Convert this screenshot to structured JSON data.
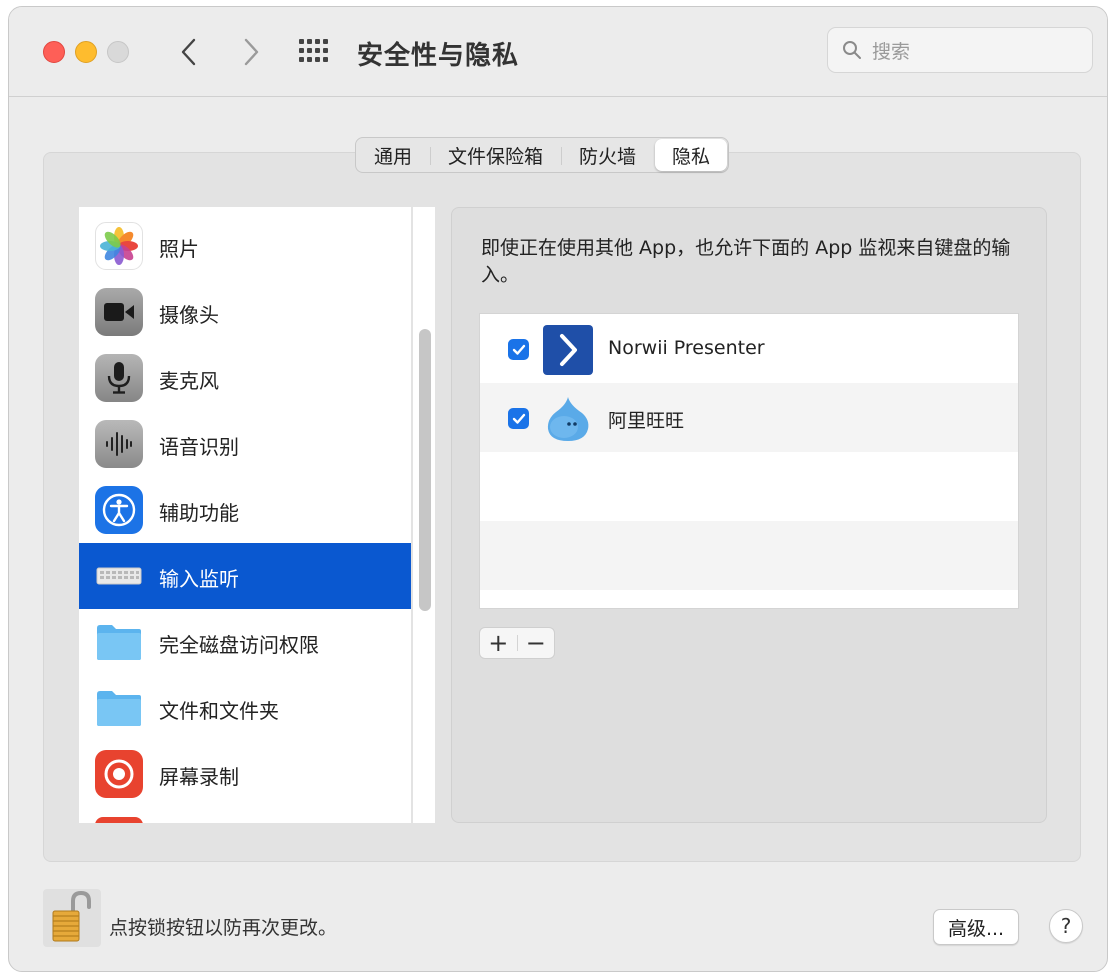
{
  "window": {
    "title": "安全性与隐私",
    "search_placeholder": "搜索"
  },
  "tabs": [
    {
      "label": "通用",
      "active": false
    },
    {
      "label": "文件保险箱",
      "active": false
    },
    {
      "label": "防火墙",
      "active": false
    },
    {
      "label": "隐私",
      "active": true
    }
  ],
  "sidebar": {
    "items": [
      {
        "label": "照片",
        "icon": "photos-icon"
      },
      {
        "label": "摄像头",
        "icon": "camera-icon"
      },
      {
        "label": "麦克风",
        "icon": "microphone-icon"
      },
      {
        "label": "语音识别",
        "icon": "speech-recognition-icon"
      },
      {
        "label": "辅助功能",
        "icon": "accessibility-icon"
      },
      {
        "label": "输入监听",
        "icon": "keyboard-icon",
        "selected": true
      },
      {
        "label": "完全磁盘访问权限",
        "icon": "folder-icon"
      },
      {
        "label": "文件和文件夹",
        "icon": "folder-icon"
      },
      {
        "label": "屏幕录制",
        "icon": "screen-recording-icon"
      }
    ]
  },
  "main": {
    "description": "即使正在使用其他 App，也允许下面的 App 监视来自键盘的输入。",
    "apps": [
      {
        "name": "Norwii Presenter",
        "checked": true,
        "icon": "norwii-icon"
      },
      {
        "name": "阿里旺旺",
        "checked": true,
        "icon": "aliwangwang-icon"
      }
    ],
    "add_label": "+",
    "remove_label": "−"
  },
  "footer": {
    "lock_text": "点按锁按钮以防再次更改。",
    "advanced_label": "高级...",
    "help_label": "?"
  },
  "colors": {
    "selection": "#0a58d0",
    "checkbox": "#1a73e8"
  }
}
